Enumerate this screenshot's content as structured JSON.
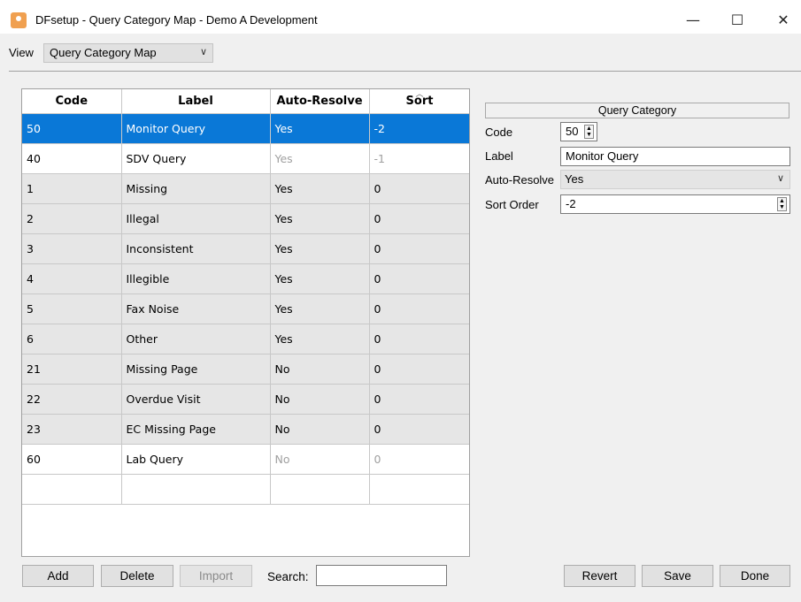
{
  "window": {
    "title": "DFsetup - Query Category Map - Demo A Development",
    "minimize": "—",
    "maximize": "☐",
    "close": "✕"
  },
  "view": {
    "label": "View",
    "selected": "Query Category Map",
    "chevron": "∨"
  },
  "table": {
    "headers": [
      "Code",
      "Label",
      "Auto-Resolve",
      "Sort"
    ],
    "sort_caret": "︿",
    "rows": [
      {
        "code": "50",
        "label": "Monitor Query",
        "auto": "Yes",
        "sort": "-2"
      },
      {
        "code": "40",
        "label": "SDV Query",
        "auto": "Yes",
        "sort": "-1"
      },
      {
        "code": "1",
        "label": "Missing",
        "auto": "Yes",
        "sort": "0"
      },
      {
        "code": "2",
        "label": "Illegal",
        "auto": "Yes",
        "sort": "0"
      },
      {
        "code": "3",
        "label": "Inconsistent",
        "auto": "Yes",
        "sort": "0"
      },
      {
        "code": "4",
        "label": "Illegible",
        "auto": "Yes",
        "sort": "0"
      },
      {
        "code": "5",
        "label": "Fax Noise",
        "auto": "Yes",
        "sort": "0"
      },
      {
        "code": "6",
        "label": "Other",
        "auto": "Yes",
        "sort": "0"
      },
      {
        "code": "21",
        "label": "Missing Page",
        "auto": "No",
        "sort": "0"
      },
      {
        "code": "22",
        "label": "Overdue Visit",
        "auto": "No",
        "sort": "0"
      },
      {
        "code": "23",
        "label": "EC Missing Page",
        "auto": "No",
        "sort": "0"
      },
      {
        "code": "60",
        "label": "Lab Query",
        "auto": "No",
        "sort": "0"
      }
    ]
  },
  "bottom": {
    "add": "Add",
    "delete": "Delete",
    "import": "Import",
    "search_label": "Search:",
    "revert": "Revert",
    "save": "Save",
    "done": "Done"
  },
  "panel": {
    "header": "Query Category",
    "code_label": "Code",
    "code_value": "50",
    "label_label": "Label",
    "label_value": "Monitor Query",
    "auto_label": "Auto-Resolve",
    "auto_value": "Yes",
    "sort_label": "Sort Order",
    "sort_value": "-2",
    "chevron": "∨"
  },
  "colors": {
    "selection": "#0a78d7",
    "row_gray": "#e6e6e6",
    "dim_text": "#a0a0a0"
  }
}
